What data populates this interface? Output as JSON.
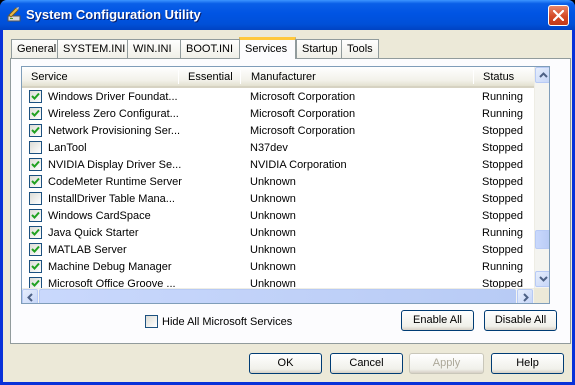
{
  "window": {
    "title": "System Configuration Utility"
  },
  "tabs": [
    {
      "label": "General"
    },
    {
      "label": "SYSTEM.INI"
    },
    {
      "label": "WIN.INI"
    },
    {
      "label": "BOOT.INI"
    },
    {
      "label": "Services",
      "active": true
    },
    {
      "label": "Startup"
    },
    {
      "label": "Tools"
    }
  ],
  "columns": {
    "service": "Service",
    "essential": "Essential",
    "manufacturer": "Manufacturer",
    "status": "Status"
  },
  "services": [
    {
      "checked": true,
      "name": "Windows Driver Foundat...",
      "essential": "",
      "manufacturer": "Microsoft Corporation",
      "status": "Running"
    },
    {
      "checked": true,
      "name": "Wireless Zero Configurat...",
      "essential": "",
      "manufacturer": "Microsoft Corporation",
      "status": "Running"
    },
    {
      "checked": true,
      "name": "Network Provisioning Ser...",
      "essential": "",
      "manufacturer": "Microsoft Corporation",
      "status": "Stopped"
    },
    {
      "checked": false,
      "name": "LanTool",
      "essential": "",
      "manufacturer": "N37dev",
      "status": "Stopped"
    },
    {
      "checked": true,
      "name": "NVIDIA Display Driver Se...",
      "essential": "",
      "manufacturer": "NVIDIA Corporation",
      "status": "Stopped"
    },
    {
      "checked": true,
      "name": "CodeMeter Runtime Server",
      "essential": "",
      "manufacturer": "Unknown",
      "status": "Stopped"
    },
    {
      "checked": false,
      "name": "InstallDriver Table Mana...",
      "essential": "",
      "manufacturer": "Unknown",
      "status": "Stopped"
    },
    {
      "checked": true,
      "name": "Windows CardSpace",
      "essential": "",
      "manufacturer": "Unknown",
      "status": "Stopped"
    },
    {
      "checked": true,
      "name": "Java Quick Starter",
      "essential": "",
      "manufacturer": "Unknown",
      "status": "Running"
    },
    {
      "checked": true,
      "name": "MATLAB Server",
      "essential": "",
      "manufacturer": "Unknown",
      "status": "Stopped"
    },
    {
      "checked": true,
      "name": "Machine Debug Manager",
      "essential": "",
      "manufacturer": "Unknown",
      "status": "Running"
    },
    {
      "checked": true,
      "name": "Microsoft Office Groove ...",
      "essential": "",
      "manufacturer": "Unknown",
      "status": "Stopped"
    }
  ],
  "options": {
    "hide_ms_label": "Hide All Microsoft Services",
    "hide_ms_checked": false
  },
  "buttons": {
    "enable_all": "Enable All",
    "disable_all": "Disable All",
    "ok": "OK",
    "cancel": "Cancel",
    "apply": "Apply",
    "help": "Help"
  },
  "icons": {
    "title": "msconfig-icon",
    "close": "close-icon"
  },
  "colors": {
    "titlebar": "#0054e3",
    "dialog_bg": "#ece9d8",
    "tab_highlight": "#ffc83c",
    "close_button": "#d44a26"
  }
}
